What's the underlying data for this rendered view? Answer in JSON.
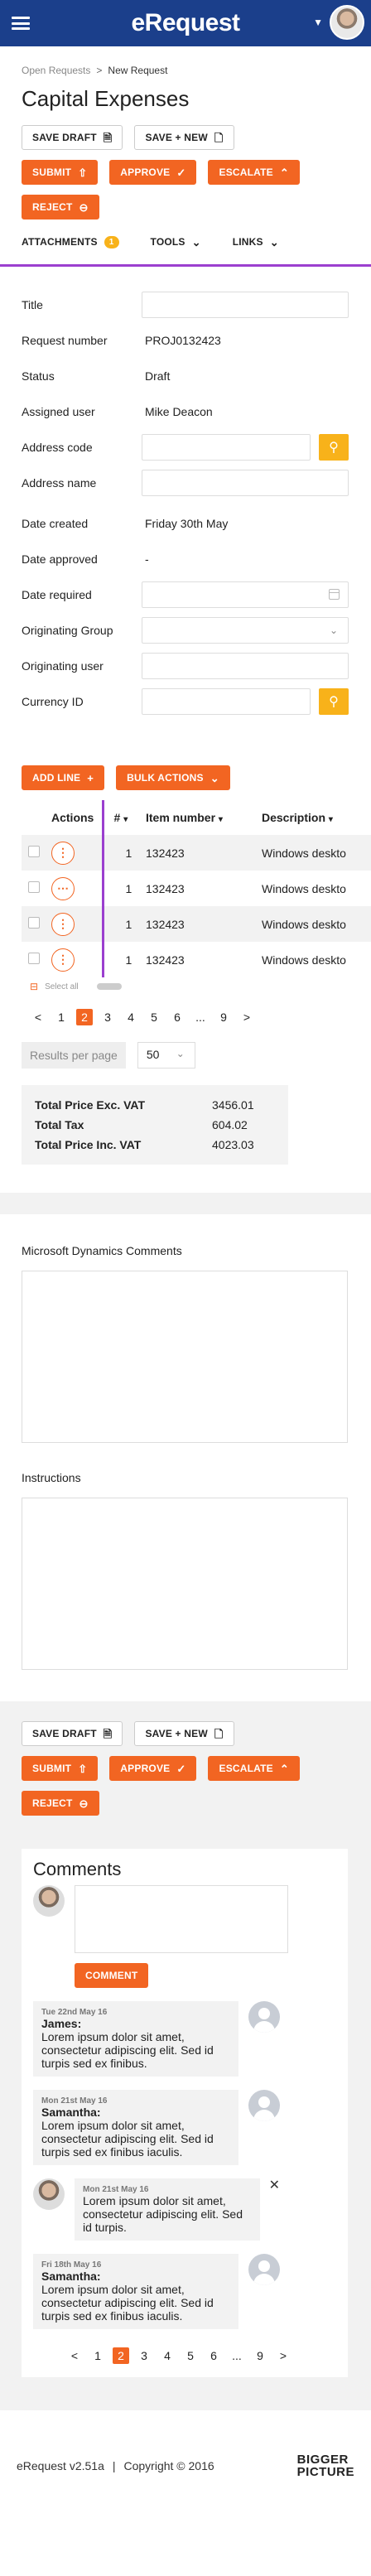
{
  "header": {
    "logo": "eRequest",
    "user_caret": "▼"
  },
  "breadcrumb": {
    "parent": "Open Requests",
    "separator": ">",
    "current": "New Request"
  },
  "page_title": "Capital Expenses",
  "toolbar": {
    "save_draft": "SAVE DRAFT",
    "save_new": "SAVE + NEW",
    "submit": "SUBMIT",
    "approve": "APPROVE",
    "escalate": "ESCALATE",
    "reject": "REJECT",
    "attachments": "ATTACHMENTS",
    "attachments_count": "1",
    "tools": "TOOLS",
    "links": "LINKS"
  },
  "form": {
    "title": {
      "label": "Title",
      "value": ""
    },
    "request_number": {
      "label": "Request number",
      "value": "PROJ0132423"
    },
    "status": {
      "label": "Status",
      "value": "Draft"
    },
    "assigned_user": {
      "label": "Assigned user",
      "value": "Mike Deacon"
    },
    "address_code": {
      "label": "Address code",
      "value": ""
    },
    "address_name": {
      "label": "Address name",
      "value": ""
    },
    "date_created": {
      "label": "Date created",
      "value": "Friday 30th May"
    },
    "date_approved": {
      "label": "Date approved",
      "value": "-"
    },
    "date_required": {
      "label": "Date required",
      "value": ""
    },
    "originating_group": {
      "label": "Originating Group",
      "value": ""
    },
    "originating_user": {
      "label": "Originating user",
      "value": ""
    },
    "currency_id": {
      "label": "Currency ID",
      "value": ""
    }
  },
  "lines": {
    "add_line": "ADD LINE",
    "bulk_actions": "BULK ACTIONS",
    "columns": {
      "actions": "Actions",
      "num": "#",
      "item_number": "Item number",
      "description": "Description"
    },
    "rows": [
      {
        "num": "1",
        "item": "132423",
        "desc": "Windows deskto"
      },
      {
        "num": "1",
        "item": "132423",
        "desc": "Windows deskto"
      },
      {
        "num": "1",
        "item": "132423",
        "desc": "Windows deskto"
      },
      {
        "num": "1",
        "item": "132423",
        "desc": "Windows deskto"
      }
    ],
    "select_all": "Select all",
    "pager": {
      "pages": [
        "1",
        "2",
        "3",
        "4",
        "5",
        "6",
        "...",
        "9"
      ],
      "active": "2",
      "prev": "<",
      "next": ">"
    },
    "results_per_page_label": "Results per page",
    "results_per_page_value": "50"
  },
  "totals": {
    "excl_label": "Total Price Exc. VAT",
    "excl_value": "3456.01",
    "tax_label": "Total Tax",
    "tax_value": "604.02",
    "incl_label": "Total Price Inc. VAT",
    "incl_value": "4023.03"
  },
  "dynamics_comments_label": "Microsoft Dynamics Comments",
  "instructions_label": "Instructions",
  "comments": {
    "title": "Comments",
    "comment_button": "COMMENT",
    "items": [
      {
        "date": "Tue 22nd May 16",
        "author": "James:",
        "text": "Lorem ipsum dolor sit amet, consectetur adipiscing elit. Sed id turpis sed ex finibus."
      },
      {
        "date": "Mon 21st May 16",
        "author": "Samantha:",
        "text": "Lorem ipsum dolor sit amet, consectetur adipiscing elit. Sed id turpis sed ex finibus iaculis."
      },
      {
        "date": "Mon 21st May 16",
        "author": "",
        "text": "Lorem ipsum dolor sit amet, consectetur adipiscing elit. Sed id turpis."
      },
      {
        "date": "Fri 18th May 16",
        "author": "Samantha:",
        "text": "Lorem ipsum dolor sit amet, consectetur adipiscing elit. Sed id turpis sed ex finibus iaculis."
      }
    ],
    "pager": {
      "pages": [
        "1",
        "2",
        "3",
        "4",
        "5",
        "6",
        "...",
        "9"
      ],
      "active": "2",
      "prev": "<",
      "next": ">"
    }
  },
  "footer": {
    "version": "eRequest v2.51a",
    "separator": "|",
    "copyright": "Copyright © 2016",
    "brand_line1": "BIGGER",
    "brand_line2": "PICTURE"
  },
  "colors": {
    "brand_blue": "#1b3f8b",
    "accent_orange": "#f26522",
    "accent_yellow": "#f8b21a",
    "purple": "#9b3fcf"
  }
}
